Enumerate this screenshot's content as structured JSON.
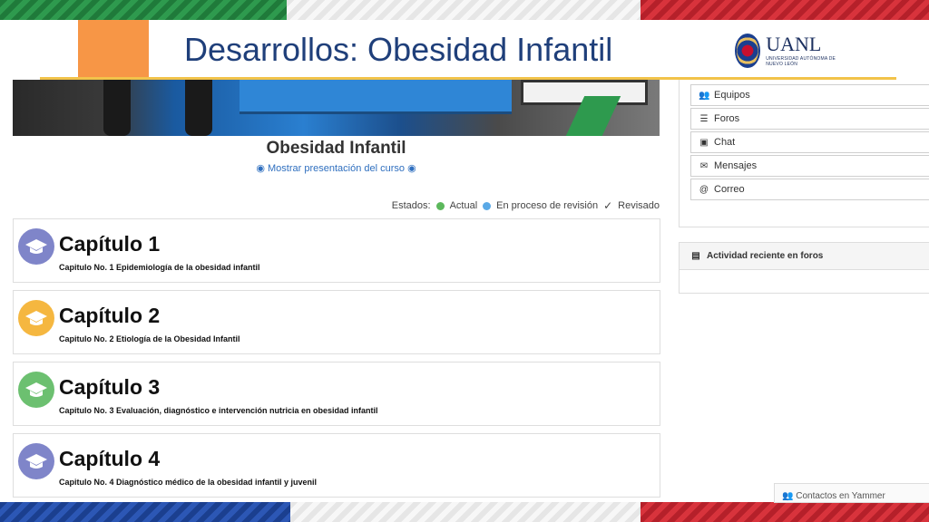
{
  "slide": {
    "title": "Desarrollos: Obesidad Infantil",
    "logo_text": "UANL",
    "logo_subtitle": "UNIVERSIDAD AUTÓNOMA DE NUEVO LEÓN"
  },
  "colors": {
    "title": "#1f3f7a",
    "accent_orange": "#f79646",
    "rule_yellow": "#f2c34a"
  },
  "course": {
    "title": "Obesidad Infantil",
    "show_presentation": "Mostrar presentación del curso"
  },
  "legend": {
    "label": "Estados:",
    "current": "Actual",
    "in_review": "En proceso de revisión",
    "reviewed": "Revisado"
  },
  "chapters": [
    {
      "name": "Capítulo 1",
      "desc": "Capitulo No. 1 Epidemiología de la obesidad infantil",
      "color": "#7f85c9"
    },
    {
      "name": "Capítulo 2",
      "desc": "Capitulo No. 2 Etiología de la Obesidad Infantil",
      "color": "#f5b740"
    },
    {
      "name": "Capítulo 3",
      "desc": "Capitulo No. 3 Evaluación, diagnóstico e intervención nutricia en obesidad infantil",
      "color": "#6cc070"
    },
    {
      "name": "Capítulo 4",
      "desc": "Capitulo No. 4 Diagnóstico médico de la obesidad infantil y juvenil",
      "color": "#7f85c9"
    }
  ],
  "sidebar": {
    "items": [
      {
        "label": "Equipos",
        "icon": "users-icon"
      },
      {
        "label": "Foros",
        "icon": "list-icon"
      },
      {
        "label": "Chat",
        "icon": "chat-icon"
      },
      {
        "label": "Mensajes",
        "icon": "envelope-icon"
      },
      {
        "label": "Correo",
        "icon": "at-icon"
      }
    ],
    "recent_activity_title": "Actividad reciente en foros",
    "bottom_label": "Contactos en Yammer"
  }
}
